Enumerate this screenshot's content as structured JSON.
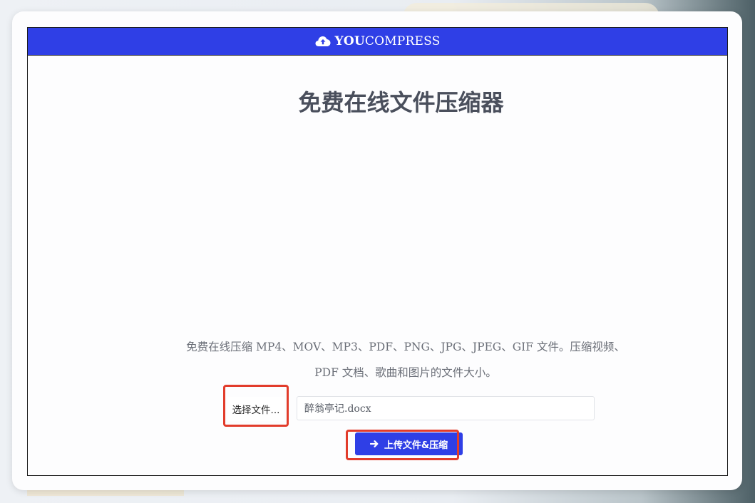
{
  "header": {
    "logo_bold": "YOU",
    "logo_light": "COMPRESS",
    "logo_icon": "cloud-upload-icon",
    "background": "#2f3fe6"
  },
  "main": {
    "title": "免费在线文件压缩器",
    "description": "免费在线压缩 MP4、MOV、MP3、PDF、PNG、JPG、JPEG、GIF 文件。压缩视频、PDF 文档、歌曲和图片的文件大小。"
  },
  "upload": {
    "choose_label": "选择文件...",
    "file_name": "醉翁亭记.docx",
    "submit_label": "上传文件&压缩",
    "submit_icon": "arrow-right-icon"
  },
  "colors": {
    "accent": "#2f3fe6",
    "highlight": "#e23c2b",
    "title_text": "#4a4f5c"
  }
}
